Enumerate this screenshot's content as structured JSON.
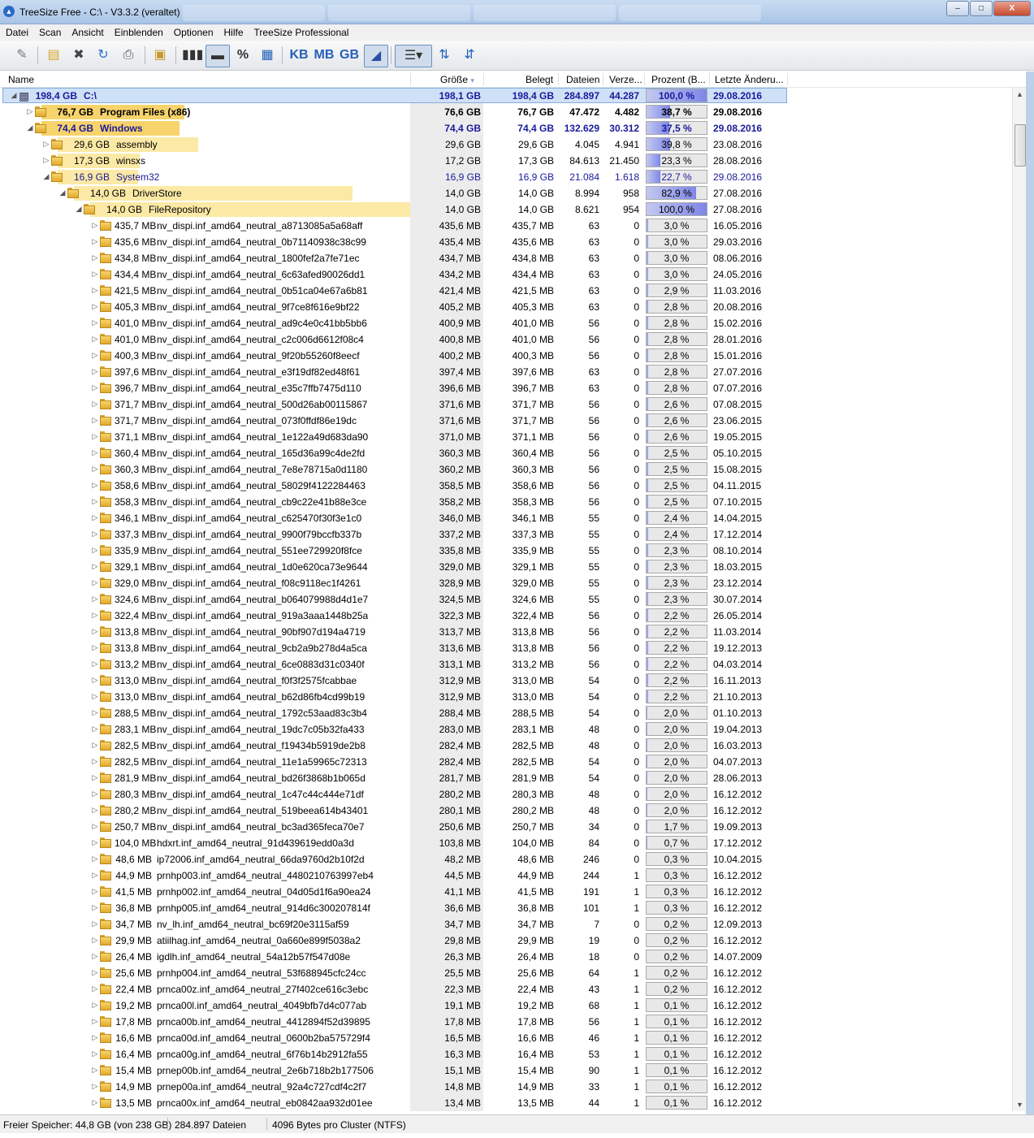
{
  "window": {
    "title": "TreeSize Free - C:\\ - V3.3.2 (veraltet)",
    "minimize": "–",
    "maximize": "□",
    "close": "X"
  },
  "menu": [
    "Datei",
    "Scan",
    "Ansicht",
    "Einblenden",
    "Optionen",
    "Hilfe",
    "TreeSize Professional"
  ],
  "toolbar": {
    "kb": "KB",
    "mb": "MB",
    "gb": "GB",
    "percent": "%",
    "icons": [
      "scan-icon",
      "folder-scan-icon",
      "stop-icon",
      "refresh-icon",
      "print-icon",
      "export-icon",
      "bar-view-icon",
      "drive-view-icon",
      "percent-icon",
      "grid-icon",
      "kb-unit",
      "mb-unit",
      "gb-unit",
      "chart-icon",
      "details-icon",
      "sort-az-icon",
      "sort-size-icon"
    ]
  },
  "columns": {
    "name": "Name",
    "size": "Größe",
    "allocated": "Belegt",
    "files": "Dateien",
    "folders": "Verze...",
    "percent": "Prozent (B...",
    "modified": "Letzte Änderu..."
  },
  "rows": [
    {
      "level": 0,
      "expanded": true,
      "label_size": "198,4 GB",
      "name": "C:\\",
      "size": "198,1 GB",
      "allocated": "198,4 GB",
      "files": "284.897",
      "folders": "44.287",
      "percent": "100,0 %",
      "pct": 100,
      "date": "29.08.2016",
      "bold": true,
      "blue": true,
      "root": true
    },
    {
      "level": 1,
      "expanded": false,
      "label_size": "76,7 GB",
      "name": "Program Files (x86)",
      "size": "76,6 GB",
      "allocated": "76,7 GB",
      "files": "47.472",
      "folders": "4.482",
      "percent": "38,7 %",
      "pct": 38.7,
      "date": "29.08.2016",
      "bold": true,
      "bar": 38.7
    },
    {
      "level": 1,
      "expanded": true,
      "label_size": "74,4 GB",
      "name": "Windows",
      "size": "74,4 GB",
      "allocated": "74,4 GB",
      "files": "132.629",
      "folders": "30.312",
      "percent": "37,5 %",
      "pct": 37.5,
      "date": "29.08.2016",
      "bold": true,
      "blue": true,
      "bar": 37.5
    },
    {
      "level": 2,
      "expanded": false,
      "label_size": "29,6 GB",
      "name": "assembly",
      "size": "29,6 GB",
      "allocated": "29,6 GB",
      "files": "4.045",
      "folders": "4.941",
      "percent": "39,8 %",
      "pct": 39.8,
      "date": "23.08.2016",
      "bar": 39.8
    },
    {
      "level": 2,
      "expanded": false,
      "label_size": "17,3 GB",
      "name": "winsxs",
      "size": "17,2 GB",
      "allocated": "17,3 GB",
      "files": "84.613",
      "folders": "21.450",
      "percent": "23,3 %",
      "pct": 23.3,
      "date": "28.08.2016",
      "bar": 23.3
    },
    {
      "level": 2,
      "expanded": true,
      "label_size": "16,9 GB",
      "name": "System32",
      "size": "16,9 GB",
      "allocated": "16,9 GB",
      "files": "21.084",
      "folders": "1.618",
      "percent": "22,7 %",
      "pct": 22.7,
      "date": "29.08.2016",
      "blue": true,
      "bar": 22.7
    },
    {
      "level": 3,
      "expanded": true,
      "label_size": "14,0 GB",
      "name": "DriverStore",
      "size": "14,0 GB",
      "allocated": "14,0 GB",
      "files": "8.994",
      "folders": "958",
      "percent": "82,9 %",
      "pct": 82.9,
      "date": "27.08.2016",
      "bar": 82.9
    },
    {
      "level": 4,
      "expanded": true,
      "label_size": "14,0 GB",
      "name": "FileRepository",
      "size": "14,0 GB",
      "allocated": "14,0 GB",
      "files": "8.621",
      "folders": "954",
      "percent": "100,0 %",
      "pct": 100,
      "date": "27.08.2016",
      "bar": 100
    },
    {
      "level": 5,
      "label_size": "435,7 MB",
      "name": "nv_dispi.inf_amd64_neutral_a8713085a5a68aff",
      "size": "435,6 MB",
      "allocated": "435,7 MB",
      "files": "63",
      "folders": "0",
      "percent": "3,0 %",
      "pct": 3.0,
      "date": "16.05.2016"
    },
    {
      "level": 5,
      "label_size": "435,6 MB",
      "name": "nv_dispi.inf_amd64_neutral_0b71140938c38c99",
      "size": "435,4 MB",
      "allocated": "435,6 MB",
      "files": "63",
      "folders": "0",
      "percent": "3,0 %",
      "pct": 3.0,
      "date": "29.03.2016"
    },
    {
      "level": 5,
      "label_size": "434,8 MB",
      "name": "nv_dispi.inf_amd64_neutral_1800fef2a7fe71ec",
      "size": "434,7 MB",
      "allocated": "434,8 MB",
      "files": "63",
      "folders": "0",
      "percent": "3,0 %",
      "pct": 3.0,
      "date": "08.06.2016"
    },
    {
      "level": 5,
      "label_size": "434,4 MB",
      "name": "nv_dispi.inf_amd64_neutral_6c63afed90026dd1",
      "size": "434,2 MB",
      "allocated": "434,4 MB",
      "files": "63",
      "folders": "0",
      "percent": "3,0 %",
      "pct": 3.0,
      "date": "24.05.2016"
    },
    {
      "level": 5,
      "label_size": "421,5 MB",
      "name": "nv_dispi.inf_amd64_neutral_0b51ca04e67a6b81",
      "size": "421,4 MB",
      "allocated": "421,5 MB",
      "files": "63",
      "folders": "0",
      "percent": "2,9 %",
      "pct": 2.9,
      "date": "11.03.2016"
    },
    {
      "level": 5,
      "label_size": "405,3 MB",
      "name": "nv_dispi.inf_amd64_neutral_9f7ce8f616e9bf22",
      "size": "405,2 MB",
      "allocated": "405,3 MB",
      "files": "63",
      "folders": "0",
      "percent": "2,8 %",
      "pct": 2.8,
      "date": "20.08.2016"
    },
    {
      "level": 5,
      "label_size": "401,0 MB",
      "name": "nv_dispi.inf_amd64_neutral_ad9c4e0c41bb5bb6",
      "size": "400,9 MB",
      "allocated": "401,0 MB",
      "files": "56",
      "folders": "0",
      "percent": "2,8 %",
      "pct": 2.8,
      "date": "15.02.2016"
    },
    {
      "level": 5,
      "label_size": "401,0 MB",
      "name": "nv_dispi.inf_amd64_neutral_c2c006d6612f08c4",
      "size": "400,8 MB",
      "allocated": "401,0 MB",
      "files": "56",
      "folders": "0",
      "percent": "2,8 %",
      "pct": 2.8,
      "date": "28.01.2016"
    },
    {
      "level": 5,
      "label_size": "400,3 MB",
      "name": "nv_dispi.inf_amd64_neutral_9f20b55260f8eecf",
      "size": "400,2 MB",
      "allocated": "400,3 MB",
      "files": "56",
      "folders": "0",
      "percent": "2,8 %",
      "pct": 2.8,
      "date": "15.01.2016"
    },
    {
      "level": 5,
      "label_size": "397,6 MB",
      "name": "nv_dispi.inf_amd64_neutral_e3f19df82ed48f61",
      "size": "397,4 MB",
      "allocated": "397,6 MB",
      "files": "63",
      "folders": "0",
      "percent": "2,8 %",
      "pct": 2.8,
      "date": "27.07.2016"
    },
    {
      "level": 5,
      "label_size": "396,7 MB",
      "name": "nv_dispi.inf_amd64_neutral_e35c7ffb7475d110",
      "size": "396,6 MB",
      "allocated": "396,7 MB",
      "files": "63",
      "folders": "0",
      "percent": "2,8 %",
      "pct": 2.8,
      "date": "07.07.2016"
    },
    {
      "level": 5,
      "label_size": "371,7 MB",
      "name": "nv_dispi.inf_amd64_neutral_500d26ab00115867",
      "size": "371,6 MB",
      "allocated": "371,7 MB",
      "files": "56",
      "folders": "0",
      "percent": "2,6 %",
      "pct": 2.6,
      "date": "07.08.2015"
    },
    {
      "level": 5,
      "label_size": "371,7 MB",
      "name": "nv_dispi.inf_amd64_neutral_073f0ffdf86e19dc",
      "size": "371,6 MB",
      "allocated": "371,7 MB",
      "files": "56",
      "folders": "0",
      "percent": "2,6 %",
      "pct": 2.6,
      "date": "23.06.2015"
    },
    {
      "level": 5,
      "label_size": "371,1 MB",
      "name": "nv_dispi.inf_amd64_neutral_1e122a49d683da90",
      "size": "371,0 MB",
      "allocated": "371,1 MB",
      "files": "56",
      "folders": "0",
      "percent": "2,6 %",
      "pct": 2.6,
      "date": "19.05.2015"
    },
    {
      "level": 5,
      "label_size": "360,4 MB",
      "name": "nv_dispi.inf_amd64_neutral_165d36a99c4de2fd",
      "size": "360,3 MB",
      "allocated": "360,4 MB",
      "files": "56",
      "folders": "0",
      "percent": "2,5 %",
      "pct": 2.5,
      "date": "05.10.2015"
    },
    {
      "level": 5,
      "label_size": "360,3 MB",
      "name": "nv_dispi.inf_amd64_neutral_7e8e78715a0d1180",
      "size": "360,2 MB",
      "allocated": "360,3 MB",
      "files": "56",
      "folders": "0",
      "percent": "2,5 %",
      "pct": 2.5,
      "date": "15.08.2015"
    },
    {
      "level": 5,
      "label_size": "358,6 MB",
      "name": "nv_dispi.inf_amd64_neutral_58029f4122284463",
      "size": "358,5 MB",
      "allocated": "358,6 MB",
      "files": "56",
      "folders": "0",
      "percent": "2,5 %",
      "pct": 2.5,
      "date": "04.11.2015"
    },
    {
      "level": 5,
      "label_size": "358,3 MB",
      "name": "nv_dispi.inf_amd64_neutral_cb9c22e41b88e3ce",
      "size": "358,2 MB",
      "allocated": "358,3 MB",
      "files": "56",
      "folders": "0",
      "percent": "2,5 %",
      "pct": 2.5,
      "date": "07.10.2015"
    },
    {
      "level": 5,
      "label_size": "346,1 MB",
      "name": "nv_dispi.inf_amd64_neutral_c625470f30f3e1c0",
      "size": "346,0 MB",
      "allocated": "346,1 MB",
      "files": "55",
      "folders": "0",
      "percent": "2,4 %",
      "pct": 2.4,
      "date": "14.04.2015"
    },
    {
      "level": 5,
      "label_size": "337,3 MB",
      "name": "nv_dispi.inf_amd64_neutral_9900f79bccfb337b",
      "size": "337,2 MB",
      "allocated": "337,3 MB",
      "files": "55",
      "folders": "0",
      "percent": "2,4 %",
      "pct": 2.4,
      "date": "17.12.2014"
    },
    {
      "level": 5,
      "label_size": "335,9 MB",
      "name": "nv_dispi.inf_amd64_neutral_551ee729920f8fce",
      "size": "335,8 MB",
      "allocated": "335,9 MB",
      "files": "55",
      "folders": "0",
      "percent": "2,3 %",
      "pct": 2.3,
      "date": "08.10.2014"
    },
    {
      "level": 5,
      "label_size": "329,1 MB",
      "name": "nv_dispi.inf_amd64_neutral_1d0e620ca73e9644",
      "size": "329,0 MB",
      "allocated": "329,1 MB",
      "files": "55",
      "folders": "0",
      "percent": "2,3 %",
      "pct": 2.3,
      "date": "18.03.2015"
    },
    {
      "level": 5,
      "label_size": "329,0 MB",
      "name": "nv_dispi.inf_amd64_neutral_f08c9118ec1f4261",
      "size": "328,9 MB",
      "allocated": "329,0 MB",
      "files": "55",
      "folders": "0",
      "percent": "2,3 %",
      "pct": 2.3,
      "date": "23.12.2014"
    },
    {
      "level": 5,
      "label_size": "324,6 MB",
      "name": "nv_dispi.inf_amd64_neutral_b064079988d4d1e7",
      "size": "324,5 MB",
      "allocated": "324,6 MB",
      "files": "55",
      "folders": "0",
      "percent": "2,3 %",
      "pct": 2.3,
      "date": "30.07.2014"
    },
    {
      "level": 5,
      "label_size": "322,4 MB",
      "name": "nv_dispi.inf_amd64_neutral_919a3aaa1448b25a",
      "size": "322,3 MB",
      "allocated": "322,4 MB",
      "files": "56",
      "folders": "0",
      "percent": "2,2 %",
      "pct": 2.2,
      "date": "26.05.2014"
    },
    {
      "level": 5,
      "label_size": "313,8 MB",
      "name": "nv_dispi.inf_amd64_neutral_90bf907d194a4719",
      "size": "313,7 MB",
      "allocated": "313,8 MB",
      "files": "56",
      "folders": "0",
      "percent": "2,2 %",
      "pct": 2.2,
      "date": "11.03.2014"
    },
    {
      "level": 5,
      "label_size": "313,8 MB",
      "name": "nv_dispi.inf_amd64_neutral_9cb2a9b278d4a5ca",
      "size": "313,6 MB",
      "allocated": "313,8 MB",
      "files": "56",
      "folders": "0",
      "percent": "2,2 %",
      "pct": 2.2,
      "date": "19.12.2013"
    },
    {
      "level": 5,
      "label_size": "313,2 MB",
      "name": "nv_dispi.inf_amd64_neutral_6ce0883d31c0340f",
      "size": "313,1 MB",
      "allocated": "313,2 MB",
      "files": "56",
      "folders": "0",
      "percent": "2,2 %",
      "pct": 2.2,
      "date": "04.03.2014"
    },
    {
      "level": 5,
      "label_size": "313,0 MB",
      "name": "nv_dispi.inf_amd64_neutral_f0f3f2575fcabbae",
      "size": "312,9 MB",
      "allocated": "313,0 MB",
      "files": "54",
      "folders": "0",
      "percent": "2,2 %",
      "pct": 2.2,
      "date": "16.11.2013"
    },
    {
      "level": 5,
      "label_size": "313,0 MB",
      "name": "nv_dispi.inf_amd64_neutral_b62d86fb4cd99b19",
      "size": "312,9 MB",
      "allocated": "313,0 MB",
      "files": "54",
      "folders": "0",
      "percent": "2,2 %",
      "pct": 2.2,
      "date": "21.10.2013"
    },
    {
      "level": 5,
      "label_size": "288,5 MB",
      "name": "nv_dispi.inf_amd64_neutral_1792c53aad83c3b4",
      "size": "288,4 MB",
      "allocated": "288,5 MB",
      "files": "54",
      "folders": "0",
      "percent": "2,0 %",
      "pct": 2.0,
      "date": "01.10.2013"
    },
    {
      "level": 5,
      "label_size": "283,1 MB",
      "name": "nv_dispi.inf_amd64_neutral_19dc7c05b32fa433",
      "size": "283,0 MB",
      "allocated": "283,1 MB",
      "files": "48",
      "folders": "0",
      "percent": "2,0 %",
      "pct": 2.0,
      "date": "19.04.2013"
    },
    {
      "level": 5,
      "label_size": "282,5 MB",
      "name": "nv_dispi.inf_amd64_neutral_f19434b5919de2b8",
      "size": "282,4 MB",
      "allocated": "282,5 MB",
      "files": "48",
      "folders": "0",
      "percent": "2,0 %",
      "pct": 2.0,
      "date": "16.03.2013"
    },
    {
      "level": 5,
      "label_size": "282,5 MB",
      "name": "nv_dispi.inf_amd64_neutral_11e1a59965c72313",
      "size": "282,4 MB",
      "allocated": "282,5 MB",
      "files": "54",
      "folders": "0",
      "percent": "2,0 %",
      "pct": 2.0,
      "date": "04.07.2013"
    },
    {
      "level": 5,
      "label_size": "281,9 MB",
      "name": "nv_dispi.inf_amd64_neutral_bd26f3868b1b065d",
      "size": "281,7 MB",
      "allocated": "281,9 MB",
      "files": "54",
      "folders": "0",
      "percent": "2,0 %",
      "pct": 2.0,
      "date": "28.06.2013"
    },
    {
      "level": 5,
      "label_size": "280,3 MB",
      "name": "nv_dispi.inf_amd64_neutral_1c47c44c444e71df",
      "size": "280,2 MB",
      "allocated": "280,3 MB",
      "files": "48",
      "folders": "0",
      "percent": "2,0 %",
      "pct": 2.0,
      "date": "16.12.2012"
    },
    {
      "level": 5,
      "label_size": "280,2 MB",
      "name": "nv_dispi.inf_amd64_neutral_519beea614b43401",
      "size": "280,1 MB",
      "allocated": "280,2 MB",
      "files": "48",
      "folders": "0",
      "percent": "2,0 %",
      "pct": 2.0,
      "date": "16.12.2012"
    },
    {
      "level": 5,
      "label_size": "250,7 MB",
      "name": "nv_dispi.inf_amd64_neutral_bc3ad365feca70e7",
      "size": "250,6 MB",
      "allocated": "250,7 MB",
      "files": "34",
      "folders": "0",
      "percent": "1,7 %",
      "pct": 1.7,
      "date": "19.09.2013"
    },
    {
      "level": 5,
      "label_size": "104,0 MB",
      "name": "hdxrt.inf_amd64_neutral_91d439619edd0a3d",
      "size": "103,8 MB",
      "allocated": "104,0 MB",
      "files": "84",
      "folders": "0",
      "percent": "0,7 %",
      "pct": 0.7,
      "date": "17.12.2012"
    },
    {
      "level": 5,
      "label_size": "48,6 MB",
      "name": "ip72006.inf_amd64_neutral_66da9760d2b10f2d",
      "size": "48,2 MB",
      "allocated": "48,6 MB",
      "files": "246",
      "folders": "0",
      "percent": "0,3 %",
      "pct": 0.3,
      "date": "10.04.2015"
    },
    {
      "level": 5,
      "label_size": "44,9 MB",
      "name": "prnhp003.inf_amd64_neutral_4480210763997eb4",
      "size": "44,5 MB",
      "allocated": "44,9 MB",
      "files": "244",
      "folders": "1",
      "percent": "0,3 %",
      "pct": 0.3,
      "date": "16.12.2012"
    },
    {
      "level": 5,
      "label_size": "41,5 MB",
      "name": "prnhp002.inf_amd64_neutral_04d05d1f6a90ea24",
      "size": "41,1 MB",
      "allocated": "41,5 MB",
      "files": "191",
      "folders": "1",
      "percent": "0,3 %",
      "pct": 0.3,
      "date": "16.12.2012"
    },
    {
      "level": 5,
      "label_size": "36,8 MB",
      "name": "prnhp005.inf_amd64_neutral_914d6c300207814f",
      "size": "36,6 MB",
      "allocated": "36,8 MB",
      "files": "101",
      "folders": "1",
      "percent": "0,3 %",
      "pct": 0.3,
      "date": "16.12.2012"
    },
    {
      "level": 5,
      "label_size": "34,7 MB",
      "name": "nv_lh.inf_amd64_neutral_bc69f20e3115af59",
      "size": "34,7 MB",
      "allocated": "34,7 MB",
      "files": "7",
      "folders": "0",
      "percent": "0,2 %",
      "pct": 0.2,
      "date": "12.09.2013"
    },
    {
      "level": 5,
      "label_size": "29,9 MB",
      "name": "atiilhag.inf_amd64_neutral_0a660e899f5038a2",
      "size": "29,8 MB",
      "allocated": "29,9 MB",
      "files": "19",
      "folders": "0",
      "percent": "0,2 %",
      "pct": 0.2,
      "date": "16.12.2012"
    },
    {
      "level": 5,
      "label_size": "26,4 MB",
      "name": "igdlh.inf_amd64_neutral_54a12b57f547d08e",
      "size": "26,3 MB",
      "allocated": "26,4 MB",
      "files": "18",
      "folders": "0",
      "percent": "0,2 %",
      "pct": 0.2,
      "date": "14.07.2009"
    },
    {
      "level": 5,
      "label_size": "25,6 MB",
      "name": "prnhp004.inf_amd64_neutral_53f688945cfc24cc",
      "size": "25,5 MB",
      "allocated": "25,6 MB",
      "files": "64",
      "folders": "1",
      "percent": "0,2 %",
      "pct": 0.2,
      "date": "16.12.2012"
    },
    {
      "level": 5,
      "label_size": "22,4 MB",
      "name": "prnca00z.inf_amd64_neutral_27f402ce616c3ebc",
      "size": "22,3 MB",
      "allocated": "22,4 MB",
      "files": "43",
      "folders": "1",
      "percent": "0,2 %",
      "pct": 0.2,
      "date": "16.12.2012"
    },
    {
      "level": 5,
      "label_size": "19,2 MB",
      "name": "prnca00l.inf_amd64_neutral_4049bfb7d4c077ab",
      "size": "19,1 MB",
      "allocated": "19,2 MB",
      "files": "68",
      "folders": "1",
      "percent": "0,1 %",
      "pct": 0.1,
      "date": "16.12.2012"
    },
    {
      "level": 5,
      "label_size": "17,8 MB",
      "name": "prnca00b.inf_amd64_neutral_4412894f52d39895",
      "size": "17,8 MB",
      "allocated": "17,8 MB",
      "files": "56",
      "folders": "1",
      "percent": "0,1 %",
      "pct": 0.1,
      "date": "16.12.2012"
    },
    {
      "level": 5,
      "label_size": "16,6 MB",
      "name": "prnca00d.inf_amd64_neutral_0600b2ba575729f4",
      "size": "16,5 MB",
      "allocated": "16,6 MB",
      "files": "46",
      "folders": "1",
      "percent": "0,1 %",
      "pct": 0.1,
      "date": "16.12.2012"
    },
    {
      "level": 5,
      "label_size": "16,4 MB",
      "name": "prnca00g.inf_amd64_neutral_6f76b14b2912fa55",
      "size": "16,3 MB",
      "allocated": "16,4 MB",
      "files": "53",
      "folders": "1",
      "percent": "0,1 %",
      "pct": 0.1,
      "date": "16.12.2012"
    },
    {
      "level": 5,
      "label_size": "15,4 MB",
      "name": "prnep00b.inf_amd64_neutral_2e6b718b2b177506",
      "size": "15,1 MB",
      "allocated": "15,4 MB",
      "files": "90",
      "folders": "1",
      "percent": "0,1 %",
      "pct": 0.1,
      "date": "16.12.2012"
    },
    {
      "level": 5,
      "label_size": "14,9 MB",
      "name": "prnep00a.inf_amd64_neutral_92a4c727cdf4c2f7",
      "size": "14,8 MB",
      "allocated": "14,9 MB",
      "files": "33",
      "folders": "1",
      "percent": "0,1 %",
      "pct": 0.1,
      "date": "16.12.2012"
    },
    {
      "level": 5,
      "label_size": "13,5 MB",
      "name": "prnca00x.inf_amd64_neutral_eb0842aa932d01ee",
      "size": "13,4 MB",
      "allocated": "13,5 MB",
      "files": "44",
      "folders": "1",
      "percent": "0,1 %",
      "pct": 0.1,
      "date": "16.12.2012"
    }
  ],
  "status": {
    "free_space": "Freier Speicher: 44,8 GB  (von 238 GB)",
    "files": "284.897  Dateien",
    "cluster": "4096 Bytes pro Cluster (NTFS)"
  }
}
